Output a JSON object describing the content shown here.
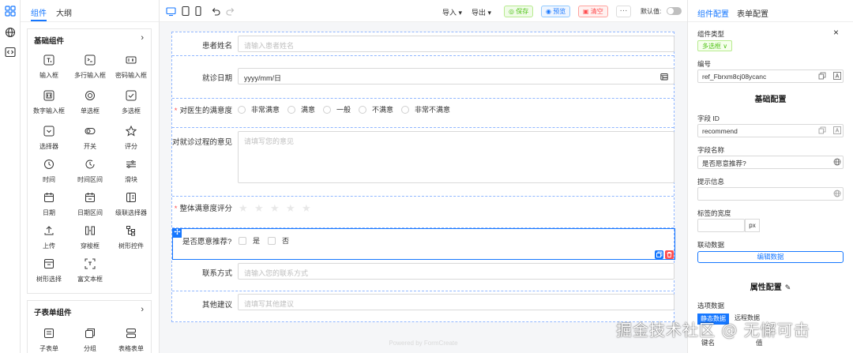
{
  "left_panel": {
    "tabs": [
      "组件",
      "大纲"
    ],
    "basic_group": {
      "title": "基础组件",
      "items": [
        "输入框",
        "多行输入框",
        "密码输入框",
        "数字输入框",
        "单选框",
        "多选框",
        "选择器",
        "开关",
        "评分",
        "时间",
        "时间区间",
        "滑块",
        "日期",
        "日期区间",
        "级联选择器",
        "上传",
        "穿梭框",
        "树形控件",
        "树形选择",
        "富文本框"
      ]
    },
    "sub_group": {
      "title": "子表单组件",
      "items": [
        "子表单",
        "分组",
        "表格表单"
      ]
    }
  },
  "toolbar": {
    "import_label": "导入",
    "export_label": "导出",
    "save_label": "保存",
    "preview_label": "预览",
    "clear_label": "清空",
    "more_label": "···",
    "default_value_label": "默认值:"
  },
  "form": {
    "fields": {
      "patient_name": {
        "label": "患者姓名",
        "placeholder": "请输入患者姓名"
      },
      "visit_date": {
        "label": "就诊日期",
        "value": "yyyy/mm/日"
      },
      "satisfaction": {
        "label": "对医生的满意度",
        "required": "*",
        "options": [
          "非常满意",
          "满意",
          "一般",
          "不满意",
          "非常不满意"
        ]
      },
      "opinion": {
        "label": "对就诊过程的意见",
        "placeholder": "请填写您的意见"
      },
      "rating": {
        "label": "整体满意度评分",
        "required": "*",
        "stars": 5
      },
      "recommend": {
        "label": "是否愿意推荐?",
        "options": [
          "是",
          "否"
        ]
      },
      "contact": {
        "label": "联系方式",
        "placeholder": "请输入您的联系方式"
      },
      "suggestion": {
        "label": "其他建议",
        "placeholder": "请填写其他建议"
      }
    },
    "powered_by": "Powered by FormCreate"
  },
  "right_panel": {
    "tabs": [
      "组件配置",
      "表单配置"
    ],
    "component_type_label": "组件类型",
    "component_type_value": "多选框",
    "id_label": "编号",
    "id_value": "ref_Fbrxm8cj08ycanc",
    "basic_config_title": "基础配置",
    "field_id_label": "字段 ID",
    "field_id_value": "recommend",
    "field_name_label": "字段名称",
    "field_name_value": "是否愿意推荐?",
    "hint_label": "提示信息",
    "hint_value": "",
    "label_width_label": "标签的宽度",
    "label_width_unit": "px",
    "linkage_label": "联动数据",
    "edit_data_label": "编辑数据",
    "attr_config_title": "属性配置",
    "options_label": "选项数据",
    "static_data_label": "静态数据",
    "remote_data_label": "远程数据",
    "key_label": "键名",
    "value_label": "值"
  },
  "watermark": "掘金技术社区 @ 无懈可击",
  "colors": {
    "accent": "#1677ff",
    "save": "#52c41a",
    "clear": "#ff4d4f"
  }
}
